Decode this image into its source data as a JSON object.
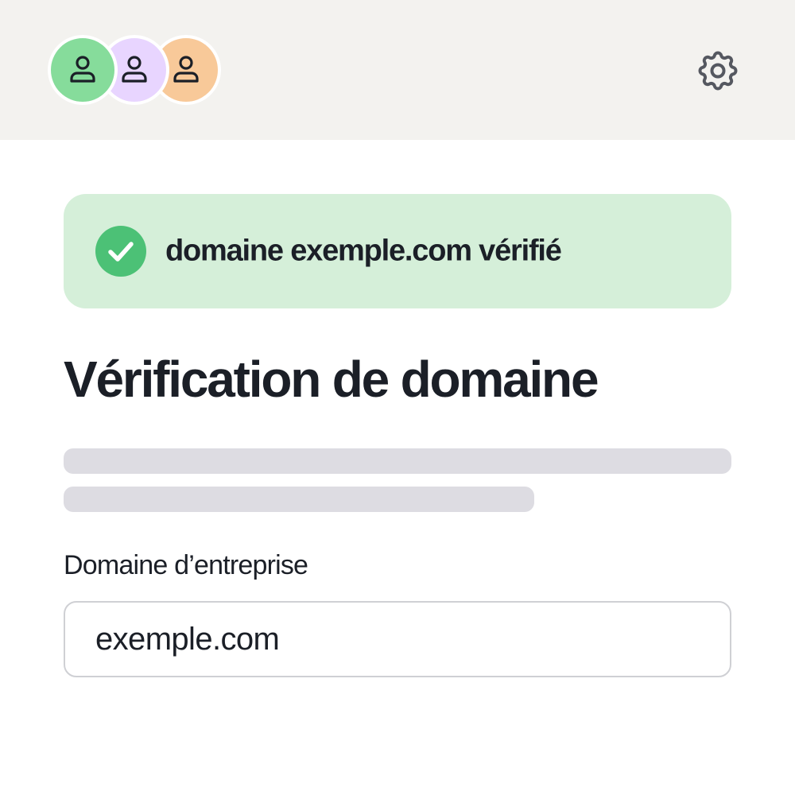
{
  "header": {
    "avatars": [
      {
        "icon": "user-icon",
        "color": "#86dc9b"
      },
      {
        "icon": "user-icon",
        "color": "#e8d5ff"
      },
      {
        "icon": "user-icon",
        "color": "#f8c999"
      }
    ],
    "settings_icon": "gear-icon",
    "background": "#f3f2ef"
  },
  "banner": {
    "icon": "check-circle-icon",
    "text": "domaine exemple.com vérifié",
    "background": "#d5efd9",
    "icon_color": "#4cc176"
  },
  "main": {
    "title": "Vérification de domaine",
    "field": {
      "label": "Domaine d’entreprise",
      "value": "exemple.com",
      "placeholder": ""
    }
  }
}
